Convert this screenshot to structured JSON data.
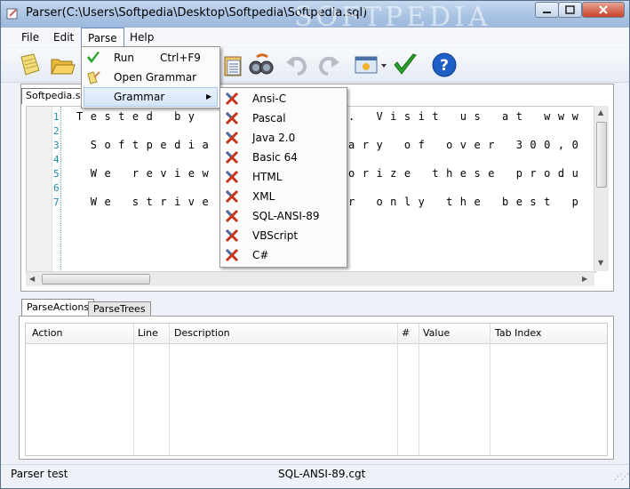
{
  "window": {
    "title": "Parser(C:\\Users\\Softpedia\\Desktop\\Softpedia\\Softpedia.sql)",
    "watermark": "SOFTPEDIA"
  },
  "menubar": {
    "items": [
      "File",
      "Edit",
      "Parse",
      "Help"
    ]
  },
  "toolbar": {
    "icons": [
      "new-icon",
      "open-icon",
      "paste-icon",
      "find-icon",
      "undo-icon",
      "redo-icon",
      "grammar-select-icon",
      "run-check-icon",
      "help-icon"
    ]
  },
  "parse_menu": {
    "run_label": "Run",
    "run_shortcut": "Ctrl+F9",
    "open_grammar_label": "Open Grammar",
    "grammar_label": "Grammar"
  },
  "grammar_menu": {
    "items": [
      "Ansi-C",
      "Pascal",
      "Java 2.0",
      "Basic 64",
      "HTML",
      "XML",
      "SQL-ANSI-89",
      "VBScript",
      "C#"
    ]
  },
  "editor": {
    "tab_label": "Softpedia.sql",
    "line_numbers": [
      "1",
      "2",
      "3",
      "4",
      "5",
      "6",
      "7"
    ],
    "lines": [
      "Tested by",
      "",
      " Softpedia",
      "",
      " We review",
      "",
      " We strive"
    ],
    "lines_right": [
      ". Visit us at www",
      "",
      "ary of over 300,0",
      "",
      "orize these produ",
      "",
      "r only the best p"
    ]
  },
  "bottom": {
    "tabs": [
      "ParseActions",
      "ParseTrees"
    ],
    "columns": [
      "Action",
      "Line",
      "Description",
      "#",
      "Value",
      "Tab Index"
    ]
  },
  "status": {
    "left": "Parser test",
    "grammar_file": "SQL-ANSI-89.cgt"
  },
  "colors": {
    "menu_hover": "#d4e5f8",
    "line_number": "#1d8aa4",
    "check_green": "#2aa12a",
    "help_blue": "#1d5fc7"
  }
}
